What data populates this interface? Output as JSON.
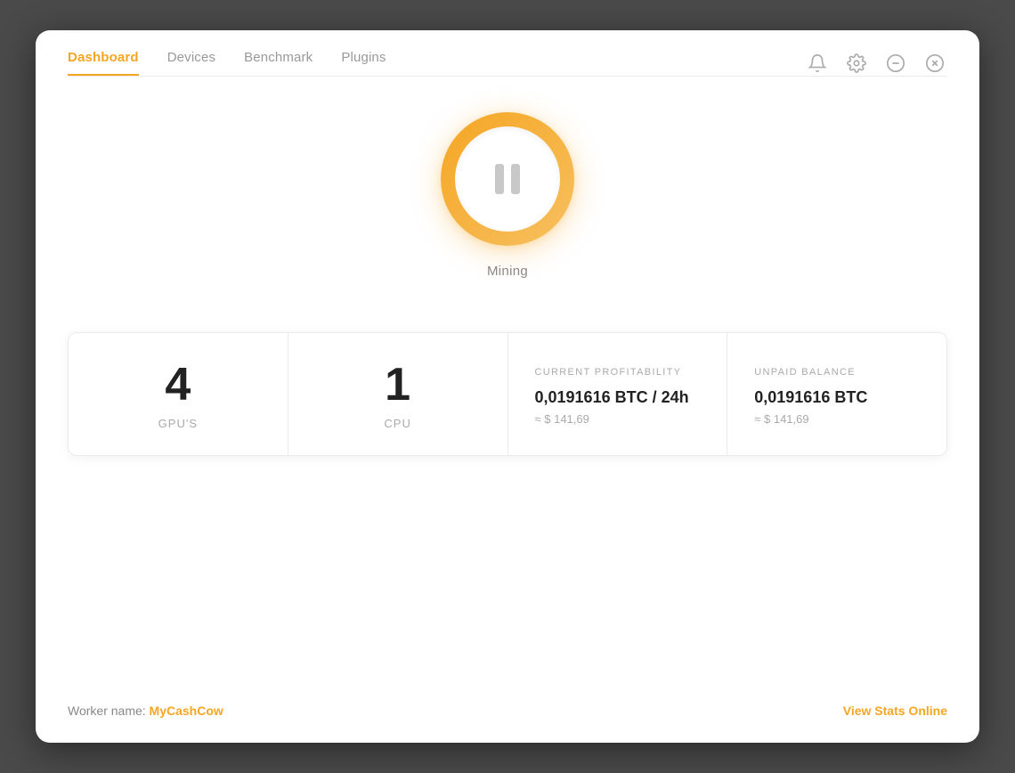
{
  "nav": {
    "items": [
      {
        "label": "Dashboard",
        "active": true
      },
      {
        "label": "Devices",
        "active": false
      },
      {
        "label": "Benchmark",
        "active": false
      },
      {
        "label": "Plugins",
        "active": false
      }
    ]
  },
  "header_actions": {
    "bell_icon": "bell",
    "gear_icon": "gear",
    "minus_icon": "minus",
    "close_icon": "close"
  },
  "mining_button": {
    "status_label": "Mining"
  },
  "stats": {
    "gpu_count": "4",
    "gpu_label": "GPU'S",
    "cpu_count": "1",
    "cpu_label": "CPU",
    "profitability_header": "CURRENT PROFITABILITY",
    "profitability_value": "0,0191616 BTC / 24h",
    "profitability_usd": "≈ $ 141,69",
    "balance_header": "UNPAID BALANCE",
    "balance_value": "0,0191616 BTC",
    "balance_usd": "≈ $ 141,69"
  },
  "footer": {
    "worker_prefix": "Worker name: ",
    "worker_name": "MyCashCow",
    "view_stats_label": "View Stats Online"
  }
}
